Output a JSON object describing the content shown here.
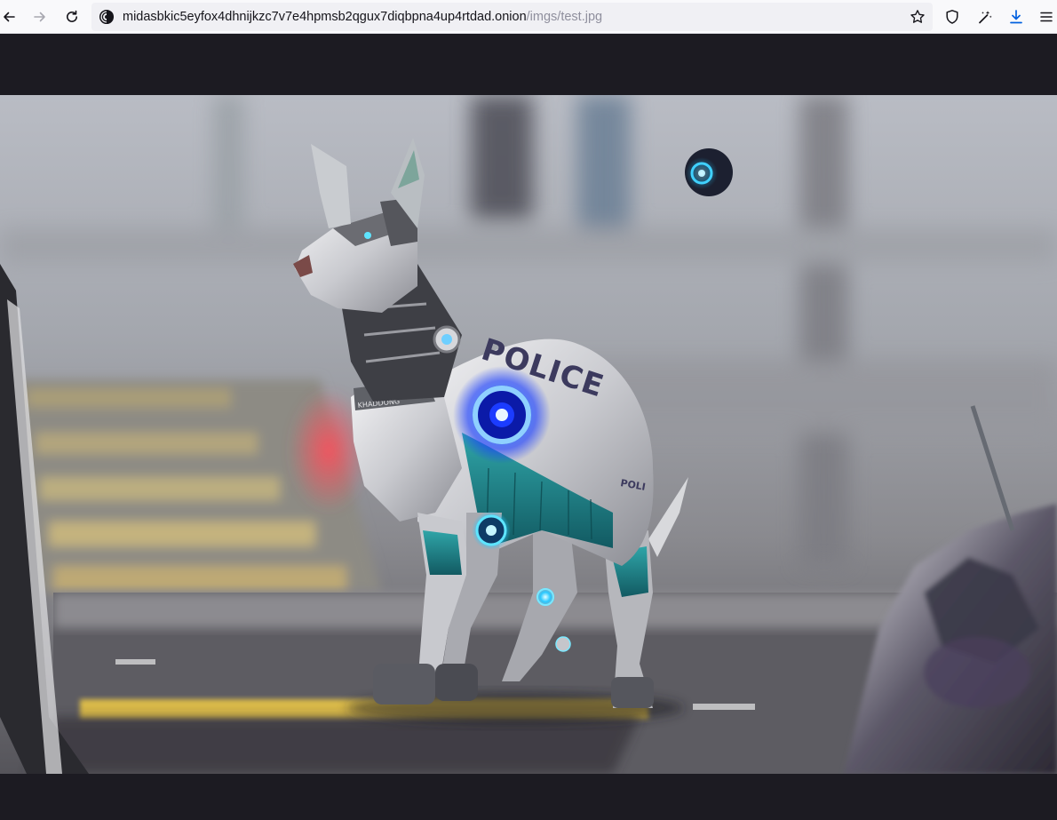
{
  "browser": {
    "url_host": "midasbkic5eyfox4dhnijkzc7v7e4hpmsb2qgux7diqbpna4up4rtdad.onion",
    "url_path": "/imgs/test.jpg",
    "icons": {
      "back": "arrow-left-icon",
      "forward": "arrow-right-icon",
      "reload": "reload-icon",
      "site": "onion-site-icon",
      "bookmark": "star-icon",
      "shield": "shield-icon",
      "extensions": "magic-wand-icon",
      "downloads": "download-icon",
      "menu": "hamburger-menu-icon"
    },
    "accent": "#0060df"
  },
  "image": {
    "subject": "robot police dog",
    "badge_text": "POLICE",
    "leg_text": "POLI",
    "collar_text": "KHADDONG"
  }
}
